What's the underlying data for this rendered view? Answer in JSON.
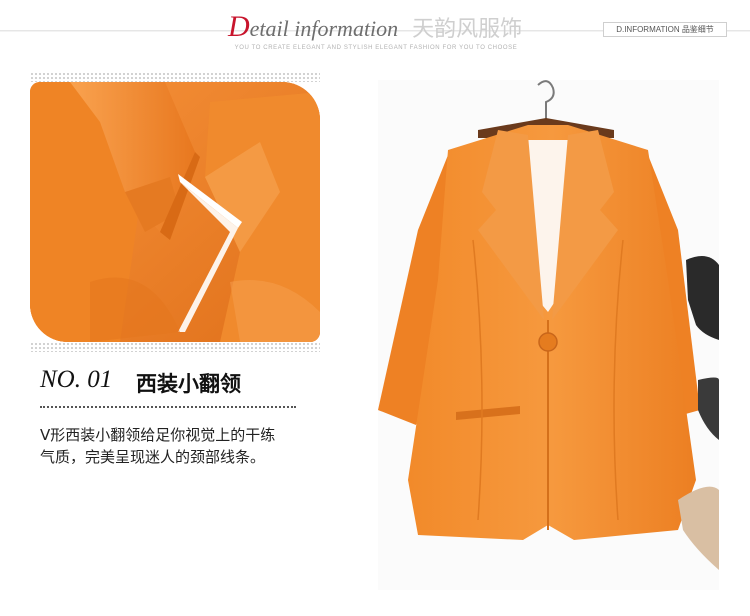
{
  "header": {
    "title_initial": "D",
    "title_rest": "etail information",
    "title_cn": "天韵风服饰",
    "subtitle": "YOU TO CREATE ELEGANT AND STYLISH ELEGANT FASHION FOR YOU TO CHOOSE",
    "badge": "D.INFORMATION 品鉴细节"
  },
  "section": {
    "number": "NO. 01",
    "title": "西装小翻领",
    "description_lines": [
      "V形西装小翻领给足你视觉上的干练",
      "气质，完美呈现迷人的颈部线条。"
    ]
  },
  "colors": {
    "accent_red": "#c8142c",
    "jacket_orange": "#f0801f"
  }
}
